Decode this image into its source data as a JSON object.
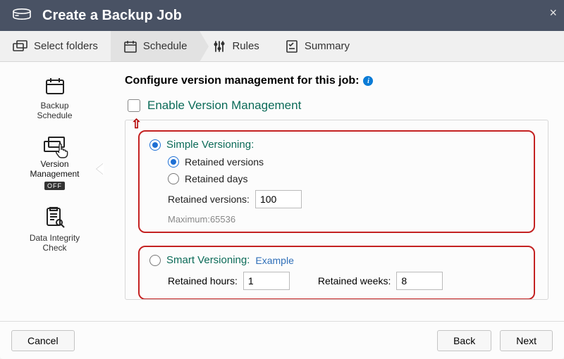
{
  "header": {
    "title": "Create a Backup Job"
  },
  "steps": {
    "select_folders": "Select folders",
    "schedule": "Schedule",
    "rules": "Rules",
    "summary": "Summary"
  },
  "sidenav": {
    "backup_schedule": "Backup\nSchedule",
    "version_management": "Version\nManagement",
    "version_badge": "OFF",
    "data_integrity": "Data Integrity\nCheck"
  },
  "content": {
    "heading": "Configure version management for this job:",
    "enable_label": "Enable Version Management",
    "simple": {
      "title": "Simple Versioning:",
      "retained_versions_opt": "Retained versions",
      "retained_days_opt": "Retained days",
      "retained_versions_label": "Retained versions:",
      "retained_versions_value": "100",
      "maximum_hint": "Maximum:65536"
    },
    "smart": {
      "title": "Smart Versioning:",
      "example": "Example",
      "retained_hours_label": "Retained hours:",
      "retained_hours_value": "1",
      "retained_weeks_label": "Retained weeks:",
      "retained_weeks_value": "8"
    }
  },
  "footer": {
    "cancel": "Cancel",
    "back": "Back",
    "next": "Next"
  }
}
